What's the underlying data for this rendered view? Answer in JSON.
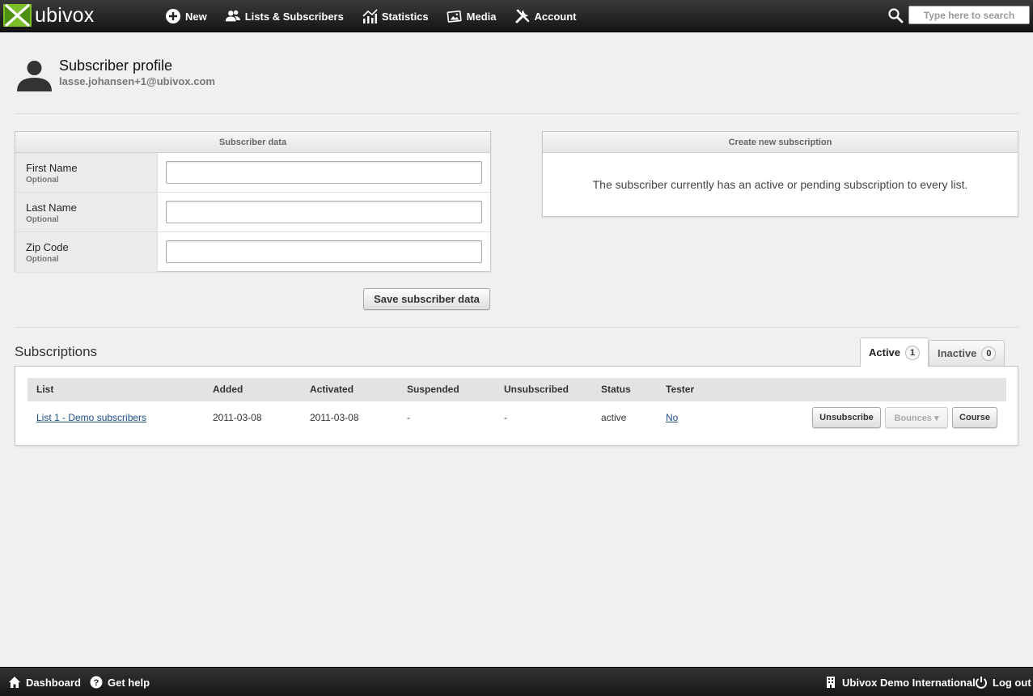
{
  "brand": {
    "name": "ubivox",
    "accent": "#7cbf2a"
  },
  "nav": {
    "new": "New",
    "lists": "Lists & Subscribers",
    "statistics": "Statistics",
    "media": "Media",
    "account": "Account"
  },
  "search": {
    "placeholder": "Type here to search"
  },
  "profile": {
    "title": "Subscriber profile",
    "email": "lasse.johansen+1@ubivox.com"
  },
  "subscriber_data": {
    "heading": "Subscriber data",
    "fields": [
      {
        "label": "First Name",
        "hint": "Optional",
        "value": ""
      },
      {
        "label": "Last Name",
        "hint": "Optional",
        "value": ""
      },
      {
        "label": "Zip Code",
        "hint": "Optional",
        "value": ""
      }
    ],
    "save_label": "Save subscriber data"
  },
  "new_subscription": {
    "heading": "Create new subscription",
    "message": "The subscriber currently has an active or pending subscription to every list."
  },
  "subscriptions": {
    "title": "Subscriptions",
    "tabs": [
      {
        "label": "Active",
        "count": "1"
      },
      {
        "label": "Inactive",
        "count": "0"
      }
    ],
    "columns": [
      "List",
      "Added",
      "Activated",
      "Suspended",
      "Unsubscribed",
      "Status",
      "Tester"
    ],
    "rows": [
      {
        "list": "List 1 - Demo subscribers",
        "added": "2011-03-08",
        "activated": "2011-03-08",
        "suspended": "-",
        "unsubscribed": "-",
        "status": "active",
        "tester": "No"
      }
    ],
    "actions": {
      "unsubscribe": "Unsubscribe",
      "bounces": "Bounces ▾",
      "course": "Course"
    }
  },
  "footer": {
    "dashboard": "Dashboard",
    "help": "Get help",
    "org": "Ubivox Demo International",
    "logout": "Log out"
  }
}
